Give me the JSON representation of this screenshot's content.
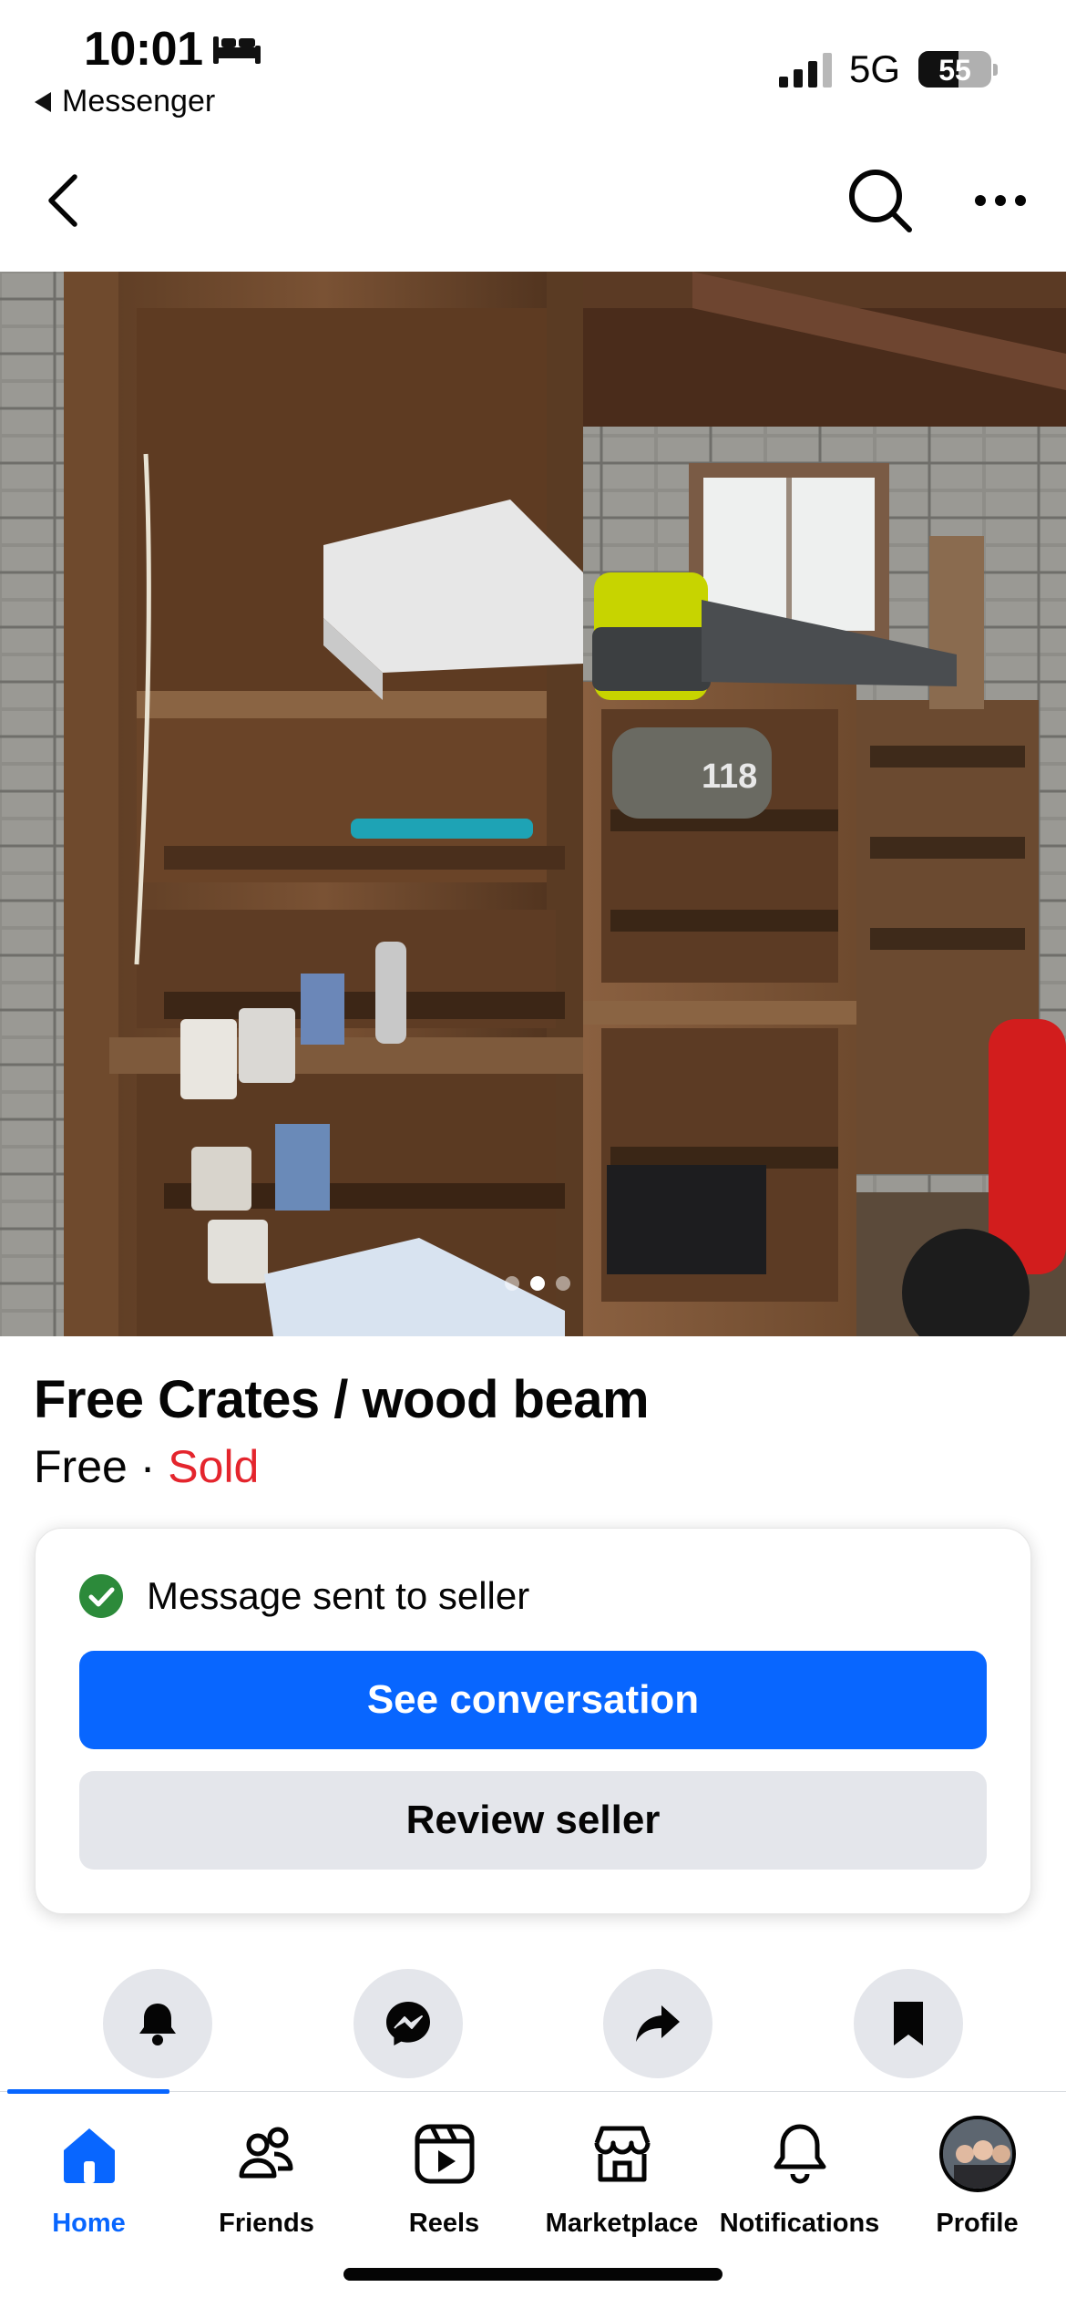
{
  "status_bar": {
    "time": "10:01",
    "back_app": "Messenger",
    "network": "5G",
    "battery": "55",
    "icons": [
      "bed-icon",
      "signal-icon",
      "battery-icon"
    ]
  },
  "nav": {
    "icons": [
      "back-arrow-icon",
      "search-icon",
      "more-icon"
    ]
  },
  "photo": {
    "slide_count": 3,
    "active_slide": 2
  },
  "listing": {
    "title": "Free Crates / wood beam",
    "price": "Free",
    "separator": "·",
    "status": "Sold",
    "status_color": "#e4252d"
  },
  "message_card": {
    "status_text": "Message sent to seller",
    "primary_button": "See conversation",
    "secondary_button": "Review seller",
    "primary_color": "#0866ff",
    "check_color": "#2c8a3a"
  },
  "actions": [
    "bell-icon",
    "messenger-icon",
    "share-icon",
    "bookmark-icon"
  ],
  "tab_bar": {
    "active": "Home",
    "tabs": [
      {
        "label": "Home",
        "icon": "home-icon"
      },
      {
        "label": "Friends",
        "icon": "friends-icon"
      },
      {
        "label": "Reels",
        "icon": "reels-icon"
      },
      {
        "label": "Marketplace",
        "icon": "marketplace-icon"
      },
      {
        "label": "Notifications",
        "icon": "notifications-icon"
      },
      {
        "label": "Profile",
        "icon": "avatar"
      }
    ]
  }
}
